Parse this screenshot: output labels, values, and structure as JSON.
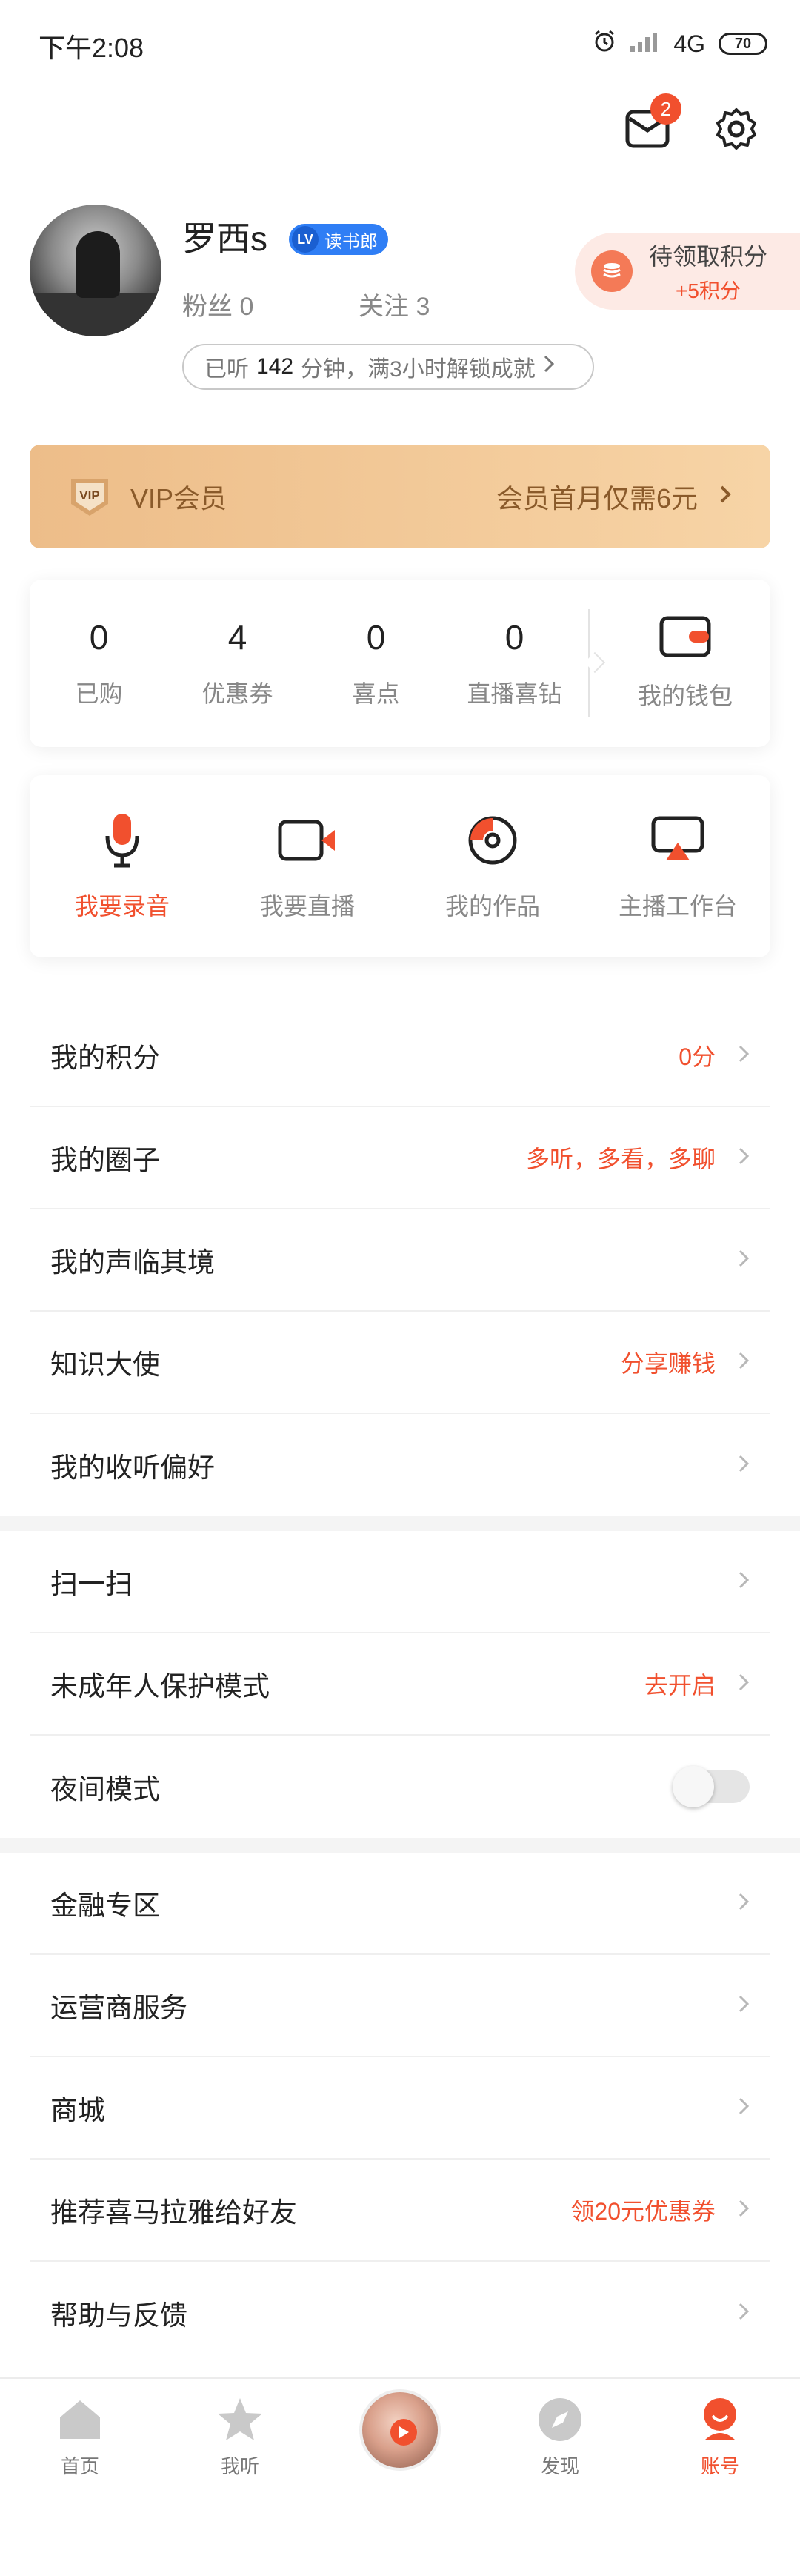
{
  "status_bar": {
    "time": "下午2:08",
    "network": "4G",
    "battery": "70"
  },
  "header": {
    "mail_badge": "2"
  },
  "profile": {
    "username": "罗西s",
    "level_badge": "LV",
    "level_name": "读书郎",
    "fans_label": "粉丝",
    "fans_count": "0",
    "follow_label": "关注",
    "follow_count": "3",
    "listen_prefix": "已听",
    "listen_minutes": "142",
    "listen_suffix": "分钟，满3小时解锁成就"
  },
  "points_card": {
    "title": "待领取积分",
    "bonus": "+5积分"
  },
  "vip": {
    "badge": "VIP",
    "label": "VIP会员",
    "promo": "会员首月仅需6元"
  },
  "stats": [
    {
      "value": "0",
      "label": "已购"
    },
    {
      "value": "4",
      "label": "优惠券"
    },
    {
      "value": "0",
      "label": "喜点"
    },
    {
      "value": "0",
      "label": "直播喜钻"
    }
  ],
  "wallet": {
    "label": "我的钱包"
  },
  "tools": [
    {
      "label": "我要录音",
      "icon": "microphone-icon"
    },
    {
      "label": "我要直播",
      "icon": "video-camera-icon"
    },
    {
      "label": "我的作品",
      "icon": "disc-icon"
    },
    {
      "label": "主播工作台",
      "icon": "workstation-icon"
    }
  ],
  "menu_group_1": [
    {
      "label": "我的积分",
      "right": "0分"
    },
    {
      "label": "我的圈子",
      "right": "多听，多看，多聊"
    },
    {
      "label": "我的声临其境",
      "right": ""
    },
    {
      "label": "知识大使",
      "right": "分享赚钱"
    },
    {
      "label": "我的收听偏好",
      "right": ""
    }
  ],
  "menu_group_2": [
    {
      "label": "扫一扫",
      "right": ""
    },
    {
      "label": "未成年人保护模式",
      "right": "去开启"
    },
    {
      "label": "夜间模式",
      "right": "",
      "toggle": false
    }
  ],
  "menu_group_3": [
    {
      "label": "金融专区",
      "right": ""
    },
    {
      "label": "运营商服务",
      "right": ""
    },
    {
      "label": "商城",
      "right": ""
    },
    {
      "label": "推荐喜马拉雅给好友",
      "right": "领20元优惠券"
    },
    {
      "label": "帮助与反馈",
      "right": ""
    }
  ],
  "tabbar": [
    {
      "label": "首页",
      "icon": "home-icon",
      "active": false
    },
    {
      "label": "我听",
      "icon": "star-icon",
      "active": false
    },
    {
      "label": "",
      "icon": "player-avatar-icon",
      "active": false
    },
    {
      "label": "发现",
      "icon": "compass-icon",
      "active": false
    },
    {
      "label": "账号",
      "icon": "account-icon",
      "active": true
    }
  ],
  "colors": {
    "accent": "#f1502e",
    "vip_start": "#edbd89",
    "vip_end": "#f7d4a6",
    "vip_text": "#8a5a2a"
  }
}
